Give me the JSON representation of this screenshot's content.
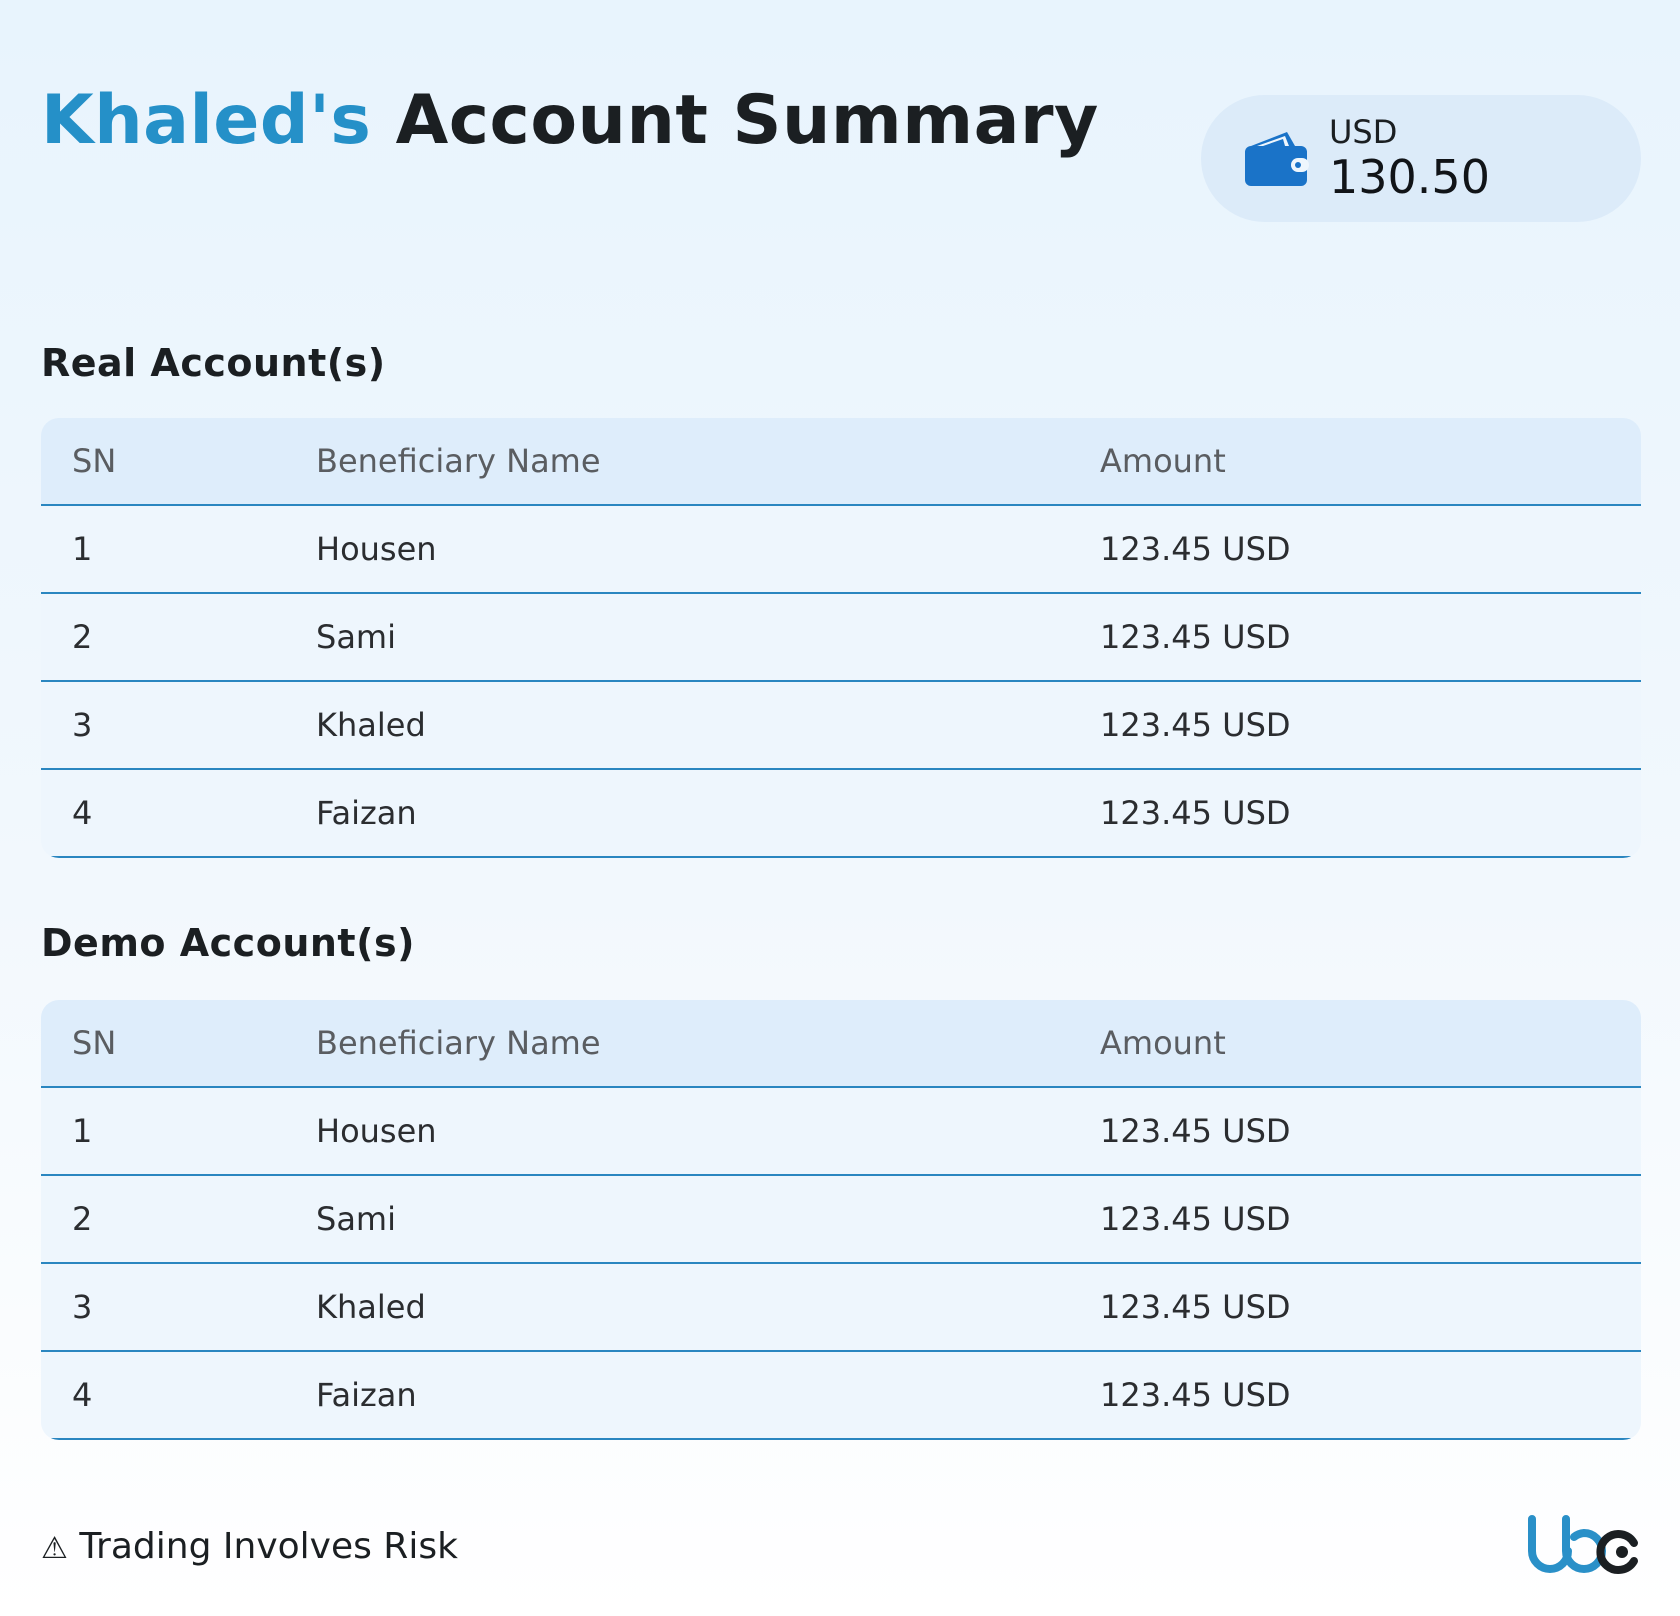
{
  "header": {
    "title_owner": "Khaled's",
    "title_rest": "Account Summary",
    "balance": {
      "icon": "wallet-icon",
      "currency": "USD",
      "amount": "130.50"
    }
  },
  "real_accounts": {
    "title": "Real Account(s)",
    "columns": [
      "SN",
      "Beneficiary Name",
      "Amount"
    ],
    "rows": [
      {
        "sn": "1",
        "name": "Housen",
        "amount": "123.45 USD"
      },
      {
        "sn": "2",
        "name": "Sami",
        "amount": "123.45 USD"
      },
      {
        "sn": "3",
        "name": "Khaled",
        "amount": "123.45 USD"
      },
      {
        "sn": "4",
        "name": "Faizan",
        "amount": "123.45 USD"
      }
    ]
  },
  "demo_accounts": {
    "title": "Demo Account(s)",
    "columns": [
      "SN",
      "Beneficiary Name",
      "Amount"
    ],
    "rows": [
      {
        "sn": "1",
        "name": "Housen",
        "amount": "123.45 USD"
      },
      {
        "sn": "2",
        "name": "Sami",
        "amount": "123.45 USD"
      },
      {
        "sn": "3",
        "name": "Khaled",
        "amount": "123.45 USD"
      },
      {
        "sn": "4",
        "name": "Faizan",
        "amount": "123.45 USD"
      }
    ]
  },
  "footer": {
    "warning_icon": "warning-icon",
    "risk_text": "Trading Involves Risk",
    "logo": "company-logo"
  },
  "colors": {
    "accent": "#2590c8",
    "divider": "#2a86c0",
    "header_fill": "#deedfb"
  }
}
